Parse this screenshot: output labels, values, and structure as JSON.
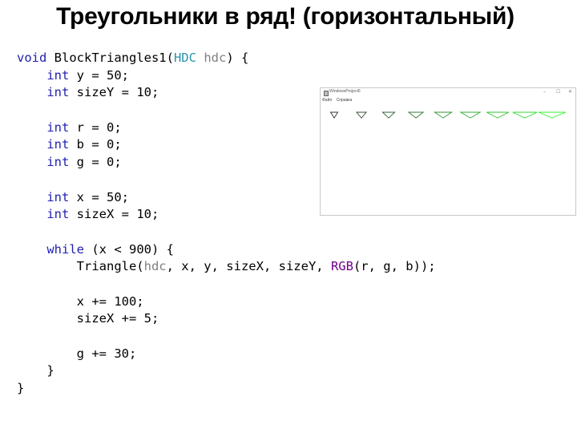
{
  "slide": {
    "title": "Треугольники в ряд! (горизонтальный)"
  },
  "code": {
    "lines": [
      [
        {
          "t": "void",
          "c": "kw"
        },
        {
          "t": " BlockTriangles1("
        },
        {
          "t": "HDC",
          "c": "type"
        },
        {
          "t": " "
        },
        {
          "t": "hdc",
          "c": "param"
        },
        {
          "t": ") {"
        }
      ],
      [
        {
          "t": "    "
        },
        {
          "t": "int",
          "c": "kw"
        },
        {
          "t": " y = 50;"
        }
      ],
      [
        {
          "t": "    "
        },
        {
          "t": "int",
          "c": "kw"
        },
        {
          "t": " sizeY = 10;"
        }
      ],
      [],
      [
        {
          "t": "    "
        },
        {
          "t": "int",
          "c": "kw"
        },
        {
          "t": " r = 0;"
        }
      ],
      [
        {
          "t": "    "
        },
        {
          "t": "int",
          "c": "kw"
        },
        {
          "t": " b = 0;"
        }
      ],
      [
        {
          "t": "    "
        },
        {
          "t": "int",
          "c": "kw"
        },
        {
          "t": " g = 0;"
        }
      ],
      [],
      [
        {
          "t": "    "
        },
        {
          "t": "int",
          "c": "kw"
        },
        {
          "t": " x = 50;"
        }
      ],
      [
        {
          "t": "    "
        },
        {
          "t": "int",
          "c": "kw"
        },
        {
          "t": " sizeX = 10;"
        }
      ],
      [],
      [
        {
          "t": "    "
        },
        {
          "t": "while",
          "c": "kw"
        },
        {
          "t": " (x < 900) {"
        }
      ],
      [
        {
          "t": "        Triangle("
        },
        {
          "t": "hdc",
          "c": "param"
        },
        {
          "t": ", x, y, sizeX, sizeY, "
        },
        {
          "t": "RGB",
          "c": "macro"
        },
        {
          "t": "(r, g, b));"
        }
      ],
      [],
      [
        {
          "t": "        x += 100;"
        }
      ],
      [
        {
          "t": "        sizeX += 5;"
        }
      ],
      [],
      [
        {
          "t": "        g += 30;"
        }
      ],
      [
        {
          "t": "    }"
        }
      ],
      [
        {
          "t": "}"
        }
      ]
    ]
  },
  "window": {
    "title": "WindowsProject6",
    "menu": [
      "Файл",
      "Справка"
    ],
    "controls": {
      "minimize": "–",
      "maximize": "☐",
      "close": "✕"
    },
    "triangles": [
      {
        "size_x": 10,
        "size_y": 10,
        "color": "#000000"
      },
      {
        "size_x": 15,
        "size_y": 10,
        "color": "#001e00"
      },
      {
        "size_x": 20,
        "size_y": 10,
        "color": "#003c00"
      },
      {
        "size_x": 25,
        "size_y": 10,
        "color": "#005a00"
      },
      {
        "size_x": 30,
        "size_y": 10,
        "color": "#007800"
      },
      {
        "size_x": 35,
        "size_y": 10,
        "color": "#009600"
      },
      {
        "size_x": 40,
        "size_y": 10,
        "color": "#00b400"
      },
      {
        "size_x": 45,
        "size_y": 10,
        "color": "#00d200"
      },
      {
        "size_x": 50,
        "size_y": 10,
        "color": "#00f000"
      }
    ]
  }
}
